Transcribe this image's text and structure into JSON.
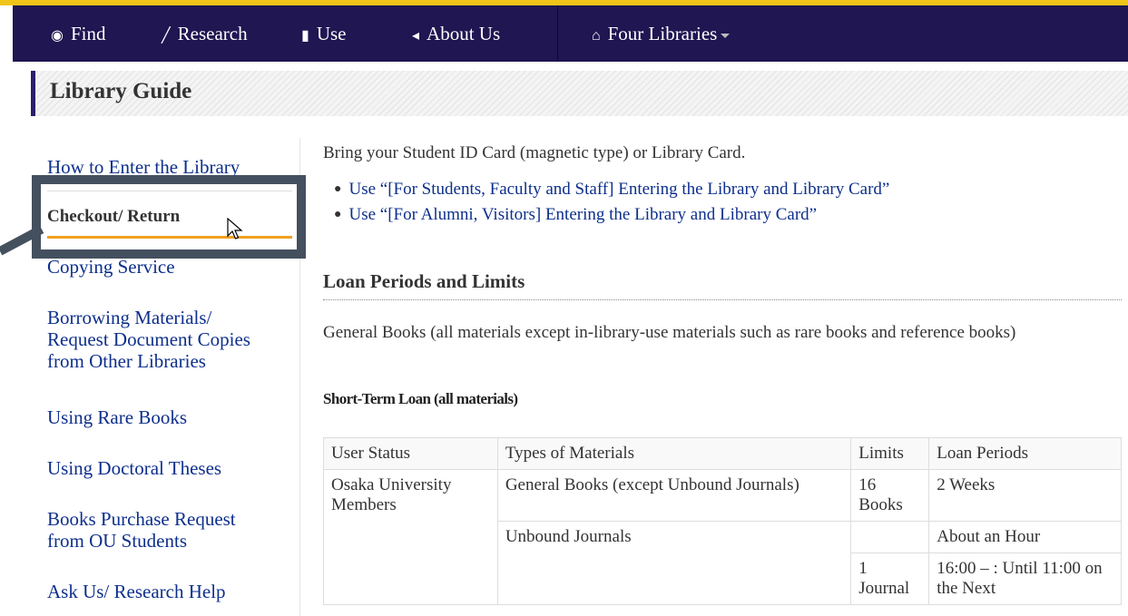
{
  "nav": {
    "items": [
      {
        "icon": "eye-icon",
        "glyph": "◉",
        "label": "Find"
      },
      {
        "icon": "pencil-icon",
        "glyph": "╱",
        "label": "Research"
      },
      {
        "icon": "book-icon",
        "glyph": "▮",
        "label": "Use"
      },
      {
        "icon": "bullhorn-icon",
        "glyph": "◂",
        "label": "About Us"
      }
    ],
    "libraries": {
      "icon": "home-icon",
      "glyph": "⌂",
      "label": "Four Libraries"
    }
  },
  "header": {
    "title": "Library Guide"
  },
  "sidebar": {
    "items": [
      {
        "label": "How to Enter the Library"
      },
      {
        "label": "Checkout/ Return",
        "active": true
      },
      {
        "label": "Copying Service"
      },
      {
        "label": "Borrowing Materials/",
        "label2": "Request Document Copies",
        "label3": "from Other Libraries"
      },
      {
        "label": "Using Rare Books"
      },
      {
        "label": "Using Doctoral Theses"
      },
      {
        "label": "Books Purchase Request",
        "label2": "from OU Students"
      },
      {
        "label": "Ask Us/ Research Help"
      }
    ]
  },
  "main": {
    "intro": "Bring your Student ID Card (magnetic type) or Library Card.",
    "links": [
      "Use “[For Students, Faculty and Staff] Entering the Library and Library Card”",
      "Use “[For Alumni, Visitors] Entering the Library and Library Card”"
    ],
    "section_title": "Loan Periods and Limits",
    "section_text": "General Books (all materials except in-library-use materials such as rare books and reference books)",
    "subheading": "Short-Term Loan (all materials)",
    "table": {
      "headers": [
        "User Status",
        "Types of Materials",
        "Limits",
        "Loan Periods"
      ],
      "rows": [
        {
          "status": "Osaka University Members",
          "type": "General Books (except Unbound Journals)",
          "limit": "16 Books",
          "period": "2 Weeks"
        },
        {
          "type": "Unbound Journals",
          "limit": "",
          "period": "About an Hour"
        },
        {
          "limit": "1 Journal",
          "period": "16:00 – : Until 11:00 on the Next"
        }
      ]
    }
  },
  "colors": {
    "navbar": "#1f1652",
    "accent": "#f0c419",
    "link": "#0d2f8c",
    "active_underline": "#f0a020",
    "highlight": "#44505e"
  }
}
